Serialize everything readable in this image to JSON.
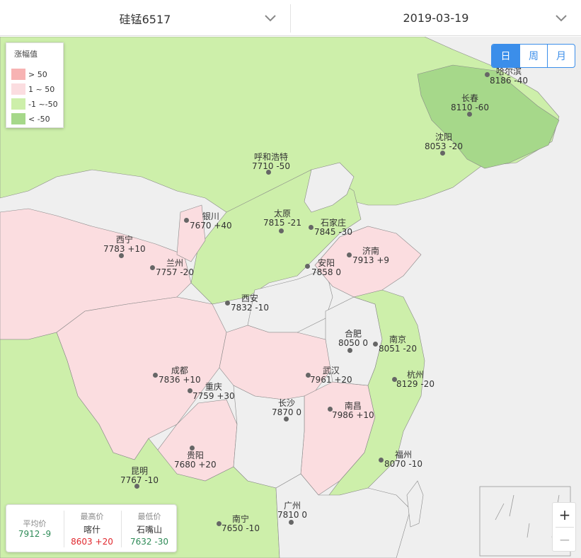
{
  "header": {
    "product": "硅锰6517",
    "date": "2019-03-19"
  },
  "legend": {
    "title": "涨幅值",
    "items": [
      {
        "label": "> 50",
        "color": "#f7b3b3"
      },
      {
        "label": "1 ~ 50",
        "color": "#fbdde0"
      },
      {
        "label": "-1 ~-50",
        "color": "#cdefaa"
      },
      {
        "label": "< -50",
        "color": "#a6d88a"
      }
    ]
  },
  "period": {
    "day": "日",
    "week": "周",
    "month": "月",
    "active": "day"
  },
  "stats": {
    "avg": {
      "label": "平均价",
      "value": "7912 -9"
    },
    "high": {
      "label": "最高价",
      "city": "喀什",
      "value": "8603 +20"
    },
    "low": {
      "label": "最低价",
      "city": "石嘴山",
      "value": "7632 -30"
    }
  },
  "cities": [
    {
      "name": "哈尔滨",
      "value": "8186 -40"
    },
    {
      "name": "长春",
      "value": "8110 -60"
    },
    {
      "name": "沈阳",
      "value": "8053 -20"
    },
    {
      "name": "呼和浩特",
      "value": "7710 -50"
    },
    {
      "name": "银川",
      "value": "7670 +40"
    },
    {
      "name": "太原",
      "value": "7815 -21"
    },
    {
      "name": "石家庄",
      "value": "7845 -30"
    },
    {
      "name": "西宁",
      "value": "7783 +10"
    },
    {
      "name": "兰州",
      "value": "7757 -20"
    },
    {
      "name": "安阳",
      "value": "7858 0"
    },
    {
      "name": "济南",
      "value": "7913 +9"
    },
    {
      "name": "西安",
      "value": "7832 -10"
    },
    {
      "name": "合肥",
      "value": "8050 0"
    },
    {
      "name": "南京",
      "value": "8051 -20"
    },
    {
      "name": "成都",
      "value": "7836 +10"
    },
    {
      "name": "武汉",
      "value": "7961 +20"
    },
    {
      "name": "杭州",
      "value": "8129 -20"
    },
    {
      "name": "重庆",
      "value": "7759 +30"
    },
    {
      "name": "长沙",
      "value": "7870 0"
    },
    {
      "name": "南昌",
      "value": "7986 +10"
    },
    {
      "name": "贵阳",
      "value": "7680 +20"
    },
    {
      "name": "福州",
      "value": "8070 -10"
    },
    {
      "name": "昆明",
      "value": "7767 -10"
    },
    {
      "name": "广州",
      "value": "7810 0"
    },
    {
      "name": "南宁",
      "value": "7650 -10"
    }
  ]
}
